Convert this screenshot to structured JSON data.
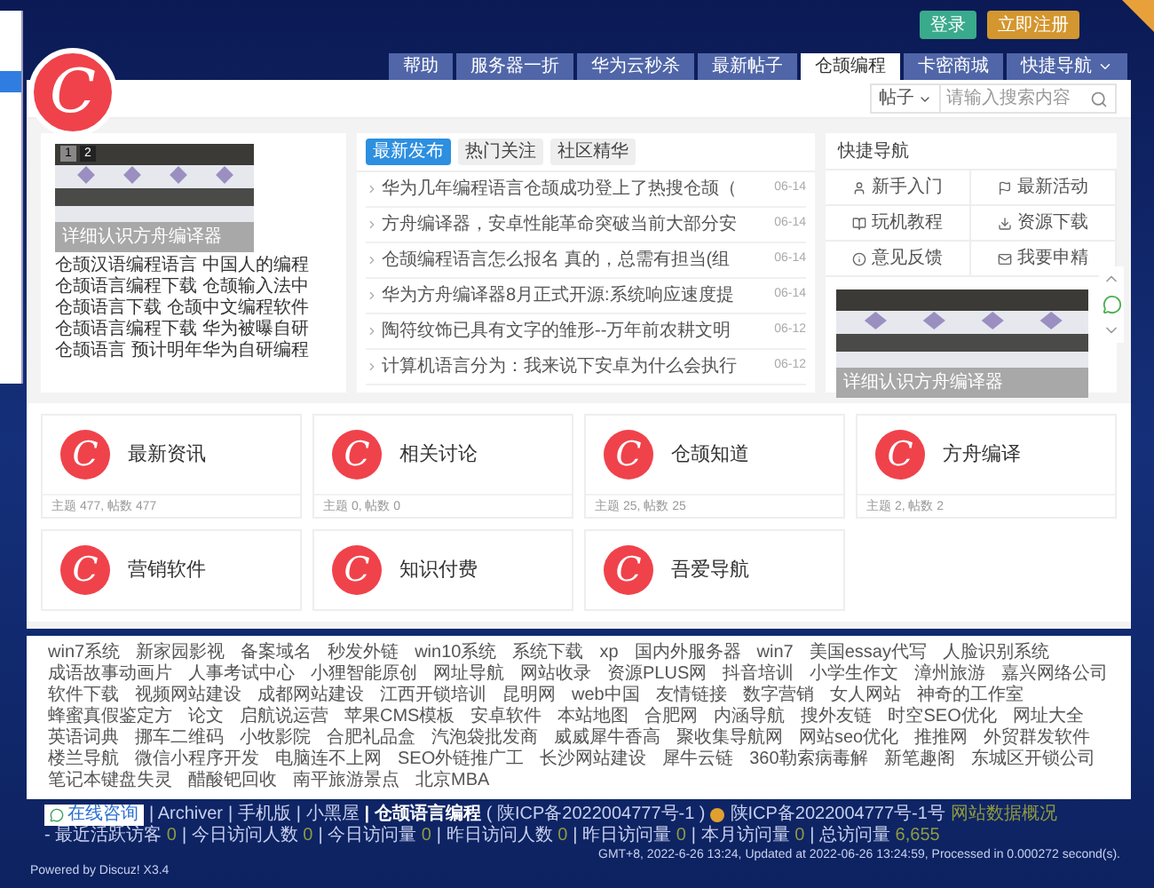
{
  "header": {
    "logo_letter": "C",
    "login_buttons": [
      {
        "label": "登录",
        "kind": "login"
      },
      {
        "label": "立即注册",
        "kind": "register"
      }
    ]
  },
  "nav_tabs": [
    {
      "label": "帮助",
      "selected": false,
      "kind": "link"
    },
    {
      "label": "服务器一折",
      "selected": false,
      "kind": "link"
    },
    {
      "label": "华为云秒杀",
      "selected": false,
      "kind": "link"
    },
    {
      "label": "最新帖子",
      "selected": false,
      "kind": "link"
    },
    {
      "label": "仓颉编程",
      "selected": true,
      "kind": "link"
    },
    {
      "label": "卡密商城",
      "selected": false,
      "kind": "link"
    },
    {
      "label": "快捷导航",
      "selected": false,
      "kind": "dropdown"
    }
  ],
  "search": {
    "scope": "帖子",
    "placeholder": "请输入搜索内容"
  },
  "slideshow": {
    "pages": [
      {
        "label": "1",
        "selected": true
      },
      {
        "label": "2",
        "selected": false
      }
    ],
    "caption": "详细认识方舟编译器",
    "lines": [
      "仓颉汉语编程语言 中国人的编程",
      "仓颉语言编程下载 仓颉输入法中",
      "仓颉语言下载 仓颉中文编程软件",
      "仓颉语言编程下载 华为被曝自研",
      "仓颉语言 预计明年华为自研编程"
    ]
  },
  "posts": {
    "tabs": [
      {
        "label": "最新发布",
        "selected": true
      },
      {
        "label": "热门关注",
        "selected": false
      },
      {
        "label": "社区精华",
        "selected": false
      }
    ],
    "items": [
      {
        "title": "华为几年编程语言仓颉成功登上了热搜仓颉（",
        "date": "06-14"
      },
      {
        "title": "方舟编译器，安卓性能革命突破当前大部分安",
        "date": "06-14"
      },
      {
        "title": "仓颉编程语言怎么报名 真的，总需有担当(组",
        "date": "06-14"
      },
      {
        "title": "华为方舟编译器8月正式开源:系统响应速度提",
        "date": "06-14"
      },
      {
        "title": "陶符纹饰已具有文字的雏形--万年前农耕文明",
        "date": "06-12"
      },
      {
        "title": "计算机语言分为：我来说下安卓为什么会执行",
        "date": "06-12"
      }
    ]
  },
  "quick_nav": {
    "title": "快捷导航",
    "items": [
      {
        "label": "新手入门",
        "kind": "user"
      },
      {
        "label": "最新活动",
        "kind": "flag"
      },
      {
        "label": "玩机教程",
        "kind": "book"
      },
      {
        "label": "资源下载",
        "kind": "download"
      },
      {
        "label": "意见反馈",
        "kind": "info"
      },
      {
        "label": "我要申精",
        "kind": "mail"
      }
    ],
    "caption": "详细认识方舟编译器"
  },
  "forums": [
    {
      "logo_letter": "C",
      "name": "最新资讯",
      "stats": "主题 477, 帖数 477"
    },
    {
      "logo_letter": "C",
      "name": "相关讨论",
      "stats": "主题 0, 帖数 0"
    },
    {
      "logo_letter": "C",
      "name": "仓颉知道",
      "stats": "主题 25, 帖数 25"
    },
    {
      "logo_letter": "C",
      "name": "方舟编译",
      "stats": "主题 2, 帖数 2"
    },
    {
      "logo_letter": "C",
      "name": "营销软件"
    },
    {
      "logo_letter": "C",
      "name": "知识付费"
    },
    {
      "logo_letter": "C",
      "name": "吾爱导航"
    }
  ],
  "footer_links": [
    [
      "win7系统",
      "新家园影视",
      "备案域名",
      "秒发外链",
      "win10系统",
      "系统下载",
      "xp",
      "国内外服务器",
      "win7",
      "美国essay代写",
      "人脸识别系统",
      "成语故事动画片"
    ],
    [
      "人事考试中心",
      "小狸智能原创",
      "网址导航",
      "网站收录",
      "资源PLUS网",
      "抖音培训",
      "小学生作文",
      "漳州旅游",
      "嘉兴网络公司",
      "软件下载",
      "视频网站建设",
      "成都网站建设"
    ],
    [
      "江西开锁培训",
      "昆明网",
      "web中国",
      "友情链接",
      "数字营销",
      "女人网站",
      "神奇的工作室",
      "蜂蜜真假鉴定方",
      "论文",
      "启航说运营",
      "苹果CMS模板",
      "安卓软件"
    ],
    [
      "本站地图",
      "合肥网",
      "内涵导航",
      "搜外友链",
      "时空SEO优化",
      "网址大全",
      "英语词典",
      "挪车二维码",
      "小牧影院",
      "合肥礼品盒",
      "汽泡袋批发商",
      "威威犀牛香高"
    ],
    [
      "聚收集导航网",
      "网站seo优化",
      "推推网",
      "外贸群发软件",
      "楼兰导航",
      "微信小程序开发",
      "电脑连不上网",
      "SEO外链推广工",
      "长沙网站建设",
      "犀牛云链",
      "360勒索病毒解",
      "新笔趣阁"
    ],
    [
      "东城区开锁公司",
      "笔记本键盘失灵",
      "醋酸钯回收",
      "南平旅游景点",
      "北京MBA"
    ]
  ],
  "bottom_bar": {
    "consult_button": "在线咨询",
    "links": [
      "| Archiver",
      "| 手机版",
      "| 小黑屋"
    ],
    "site_name": "| 仓颉语言编程",
    "icp": "( 陕ICP备2022004777号-1 )",
    "police_record": "陕ICP备2022004777号-1号",
    "stats_title": "网站数据概况",
    "stats": [
      {
        "label": "- 最近活跃访客",
        "value": "0"
      },
      {
        "label": "| 今日访问人数",
        "value": "0"
      },
      {
        "label": "| 今日访问量",
        "value": "0"
      },
      {
        "label": "| 昨日访问人数",
        "value": "0"
      },
      {
        "label": "| 昨日访问量",
        "value": "0"
      },
      {
        "label": "| 本月访问量",
        "value": "0"
      },
      {
        "label": "| 总访问量",
        "value": "6,655"
      }
    ],
    "timing": "GMT+8, 2022-6-26 13:24, Updated at 2022-06-26 13:24:59, Processed in 0.000272 second(s).",
    "powered_by": "Powered by Discuz! X3.4"
  }
}
